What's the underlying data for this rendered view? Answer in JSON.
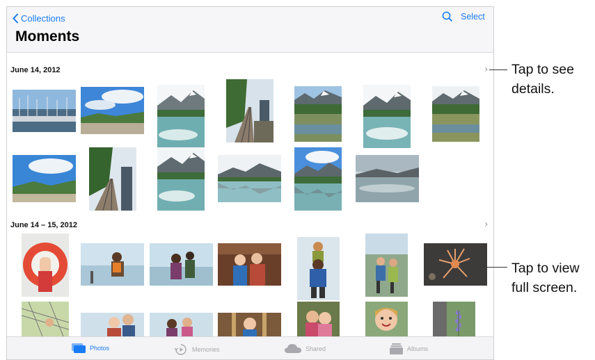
{
  "nav": {
    "back_label": "Collections",
    "select_label": "Select",
    "title": "Moments"
  },
  "sections": [
    {
      "date": "June 14, 2012"
    },
    {
      "date": "June 14 – 15, 2012"
    }
  ],
  "tabs": [
    {
      "label": "Photos",
      "icon": "photos-icon",
      "active": true
    },
    {
      "label": "Memories",
      "icon": "memories-icon",
      "active": false
    },
    {
      "label": "Shared",
      "icon": "cloud-icon",
      "active": false
    },
    {
      "label": "Albums",
      "icon": "albums-icon",
      "active": false
    }
  ],
  "callouts": {
    "details": "Tap to see details.",
    "fullscreen": "Tap to view full screen."
  },
  "colors": {
    "accent": "#1a7cf5",
    "inactive": "#a8a8ae"
  }
}
